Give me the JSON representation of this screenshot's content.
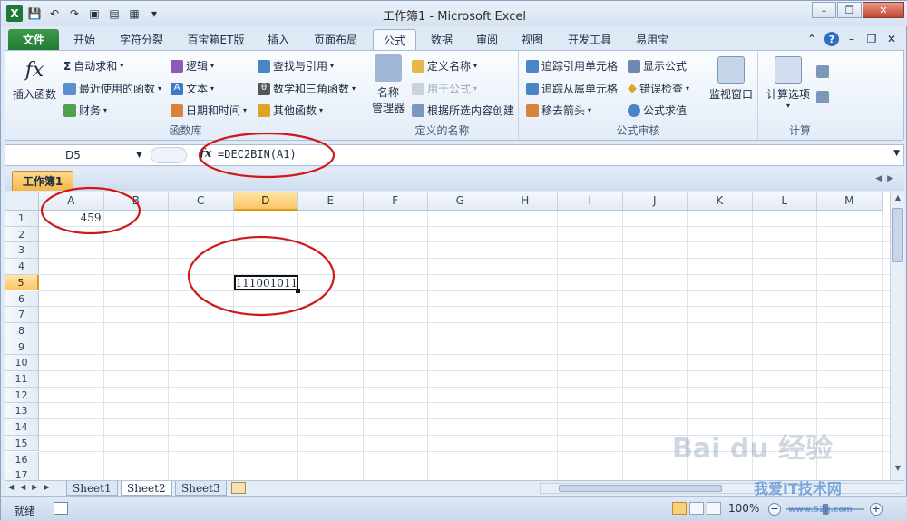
{
  "window": {
    "title": "工作簿1 - Microsoft Excel"
  },
  "ribbon_tabs": [
    {
      "label": "文件"
    },
    {
      "label": "开始"
    },
    {
      "label": "字符分裂"
    },
    {
      "label": "百宝箱ET版"
    },
    {
      "label": "插入"
    },
    {
      "label": "页面布局"
    },
    {
      "label": "公式"
    },
    {
      "label": "数据"
    },
    {
      "label": "审阅"
    },
    {
      "label": "视图"
    },
    {
      "label": "开发工具"
    },
    {
      "label": "易用宝"
    }
  ],
  "active_tab": "公式",
  "ribbon": {
    "function_library": {
      "insert_function": "插入函数",
      "autosum": "自动求和",
      "recent": "最近使用的函数",
      "financial": "财务",
      "logical": "逻辑",
      "text": "文本",
      "datetime": "日期和时间",
      "lookup": "查找与引用",
      "math": "数学和三角函数",
      "more": "其他函数",
      "label": "函数库"
    },
    "defined_names": {
      "name_manager_1": "名称",
      "name_manager_2": "管理器",
      "define_name": "定义名称",
      "use_in_formula": "用于公式",
      "create_from_selection": "根据所选内容创建",
      "label": "定义的名称"
    },
    "formula_auditing": {
      "trace_precedents": "追踪引用单元格",
      "trace_dependents": "追踪从属单元格",
      "remove_arrows": "移去箭头",
      "show_formulas": "显示公式",
      "error_checking": "错误检查",
      "evaluate": "公式求值",
      "watch_window": "监视窗口",
      "label": "公式审核"
    },
    "calculation": {
      "options": "计算选项",
      "label": "计算"
    }
  },
  "formula_bar": {
    "name_box": "D5",
    "fx": "fx",
    "formula": "=DEC2BIN(A1)"
  },
  "workbook_tab": "工作簿1",
  "columns": [
    "A",
    "B",
    "C",
    "D",
    "E",
    "F",
    "G",
    "H",
    "I",
    "J",
    "K",
    "L",
    "M"
  ],
  "selected_column": "D",
  "rows": [
    "1",
    "2",
    "3",
    "4",
    "5",
    "6",
    "7",
    "8",
    "9",
    "10",
    "11",
    "12",
    "13",
    "14",
    "15",
    "16",
    "17"
  ],
  "selected_row": "5",
  "cells": {
    "A1": "459",
    "D5": "111001011"
  },
  "sheets": [
    {
      "label": "Sheet1"
    },
    {
      "label": "Sheet2"
    },
    {
      "label": "Sheet3"
    }
  ],
  "active_sheet": "Sheet2",
  "status_bar": {
    "ready": "就绪",
    "zoom": "100%"
  },
  "watermark": {
    "brand": "Bai du 经验",
    "site": "我爱IT技术网",
    "url": "www.52ij.com"
  },
  "colors": {
    "file_tab": "#237a33",
    "selection_header": "#f9c764",
    "annotation_red": "#d01818"
  }
}
